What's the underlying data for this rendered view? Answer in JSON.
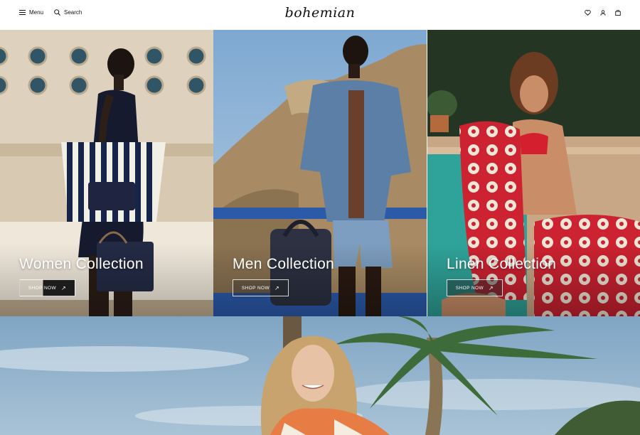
{
  "header": {
    "menu_label": "Menu",
    "search_label": "Search",
    "logo": "bohemian",
    "icons": [
      "heart-icon",
      "user-icon",
      "shopping-bag-icon"
    ]
  },
  "tiles": [
    {
      "title": "Women Collection",
      "button": "SHOP NOW",
      "icon": "arrow-up-right-icon"
    },
    {
      "title": "Men Collection",
      "button": "SHOP NOW",
      "icon": "arrow-up-right-icon"
    },
    {
      "title": "Linen Collection",
      "button": "SHOP NOW",
      "icon": "arrow-up-right-icon"
    }
  ],
  "colors": {
    "text": "#111111",
    "background": "#ffffff",
    "overlay_text": "#ffffff",
    "women_bg": "#d9cbb5",
    "men_sky": "#8fb5d6",
    "linen_pool": "#2fa39a",
    "linen_red": "#cc2231"
  }
}
